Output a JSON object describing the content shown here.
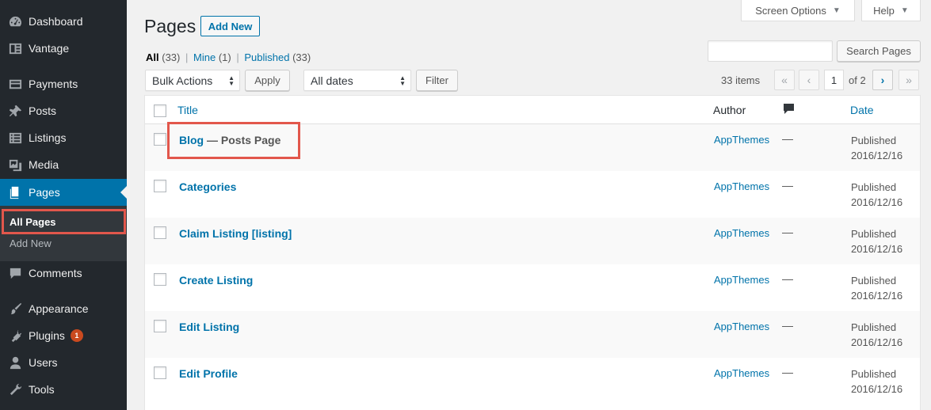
{
  "sidebar": {
    "items": [
      {
        "label": "Dashboard",
        "icon": "dashboard-icon"
      },
      {
        "label": "Vantage",
        "icon": "vantage-icon"
      },
      {
        "label": "Payments",
        "icon": "payments-icon"
      },
      {
        "label": "Posts",
        "icon": "pin-icon"
      },
      {
        "label": "Listings",
        "icon": "listings-icon"
      },
      {
        "label": "Media",
        "icon": "media-icon"
      },
      {
        "label": "Pages",
        "icon": "pages-icon"
      },
      {
        "label": "Comments",
        "icon": "comment-icon"
      },
      {
        "label": "Appearance",
        "icon": "brush-icon"
      },
      {
        "label": "Plugins",
        "icon": "plug-icon",
        "badge": "1"
      },
      {
        "label": "Users",
        "icon": "user-icon"
      },
      {
        "label": "Tools",
        "icon": "wrench-icon"
      }
    ],
    "submenu": [
      "All Pages",
      "Add New"
    ]
  },
  "header": {
    "screen_options": "Screen Options",
    "help": "Help",
    "title": "Pages",
    "add_new": "Add New"
  },
  "views": {
    "all": "All",
    "all_count": "(33)",
    "mine": "Mine",
    "mine_count": "(1)",
    "published": "Published",
    "published_count": "(33)",
    "sep": "|"
  },
  "search": {
    "button": "Search Pages",
    "value": ""
  },
  "toolbar": {
    "bulk_actions": "Bulk Actions",
    "apply": "Apply",
    "dates": "All dates",
    "filter": "Filter",
    "items": "33 items",
    "first": "«",
    "prev": "‹",
    "page": "1",
    "of": "of 2",
    "next": "›",
    "last": "»"
  },
  "table": {
    "columns": {
      "title": "Title",
      "author": "Author",
      "date": "Date"
    },
    "rows": [
      {
        "title": "Blog",
        "state": " — Posts Page",
        "author": "AppThemes",
        "comments": "—",
        "status": "Published",
        "date": "2016/12/16"
      },
      {
        "title": "Categories",
        "state": "",
        "author": "AppThemes",
        "comments": "—",
        "status": "Published",
        "date": "2016/12/16"
      },
      {
        "title": "Claim Listing [listing]",
        "state": "",
        "author": "AppThemes",
        "comments": "—",
        "status": "Published",
        "date": "2016/12/16"
      },
      {
        "title": "Create Listing",
        "state": "",
        "author": "AppThemes",
        "comments": "—",
        "status": "Published",
        "date": "2016/12/16"
      },
      {
        "title": "Edit Listing",
        "state": "",
        "author": "AppThemes",
        "comments": "—",
        "status": "Published",
        "date": "2016/12/16"
      },
      {
        "title": "Edit Profile",
        "state": "",
        "author": "AppThemes",
        "comments": "—",
        "status": "Published",
        "date": "2016/12/16"
      }
    ]
  },
  "colors": {
    "sidebar": "#23282d",
    "accent": "#0073aa",
    "highlight": "#e2574c",
    "badge": "#ca4a1f"
  }
}
